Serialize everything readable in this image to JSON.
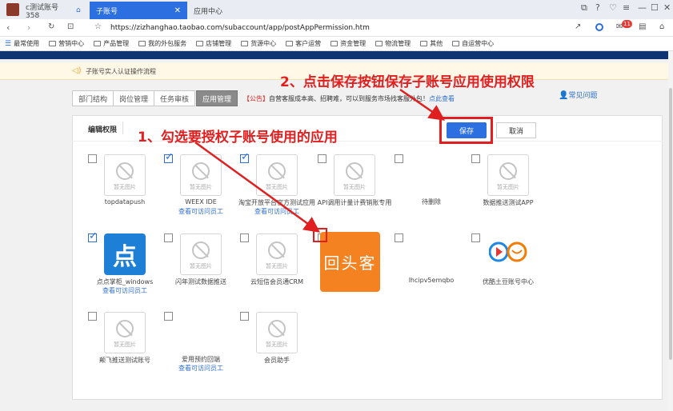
{
  "browser": {
    "tab1_title": "c测试账号358",
    "tab2_title": "子账号",
    "tab3_title": "应用中心",
    "url": "https://zizhanghao.taobao.com/subaccount/app/postAppPermission.htm",
    "mail_badge": "11"
  },
  "bookmarks": [
    "最常使用",
    "营销中心",
    "产品管理",
    "我的外包服务",
    "店铺管理",
    "货源中心",
    "客户运营",
    "资金管理",
    "物流管理",
    "其他",
    "自运营中心"
  ],
  "notice": {
    "text": "子账号实人认证操作流程"
  },
  "subtabs": [
    "部门结构",
    "岗位管理",
    "任务审核",
    "应用管理"
  ],
  "announcement": {
    "prefix": "【公告】",
    "text": "自营客服成本高、招聘难，可以到服务市场找客服外包！",
    "link": "点此查看"
  },
  "faq": "常见问题",
  "panel": {
    "title": "编辑权限",
    "save": "保存",
    "cancel": "取消"
  },
  "annotations": {
    "step1": "1、勾选要授权子账号使用的应用",
    "step2": "2、点击保存按钮保存子账号应用使用权限"
  },
  "placeholder_text": "暂无图片",
  "view_staff": "查看可访问员工",
  "apps": [
    {
      "name": "topdatapush",
      "checked": false,
      "link": false,
      "logo": "placeholder"
    },
    {
      "name": "WEEX IDE",
      "checked": true,
      "link": true,
      "logo": "placeholder"
    },
    {
      "name": "淘宝开放平台官方测试应用",
      "checked": true,
      "link": true,
      "logo": "placeholder"
    },
    {
      "name": "API调用计量计费销账专用",
      "checked": false,
      "link": false,
      "logo": "placeholder"
    },
    {
      "name": "待删除",
      "checked": false,
      "link": false,
      "logo": "none"
    },
    {
      "name": "数据推送测试APP",
      "checked": false,
      "link": false,
      "logo": "placeholder"
    },
    {
      "name": "点点掌柜_windows",
      "checked": true,
      "link": true,
      "logo": "diandian"
    },
    {
      "name": "闪年测试数据推送",
      "checked": false,
      "link": false,
      "logo": "placeholder"
    },
    {
      "name": "云短信会员通CRM",
      "checked": false,
      "link": false,
      "logo": "placeholder"
    },
    {
      "name": "回头客",
      "checked": false,
      "link": false,
      "logo": "huitouke"
    },
    {
      "name": "lhcipv5emqbo",
      "checked": false,
      "link": false,
      "logo": "none"
    },
    {
      "name": "优酷土豆账号中心",
      "checked": false,
      "link": false,
      "logo": "youku"
    },
    {
      "name": "颠飞推送测试账号",
      "checked": false,
      "link": false,
      "logo": "placeholder"
    },
    {
      "name": "爱用预约回端",
      "checked": false,
      "link": true,
      "logo": "none"
    },
    {
      "name": "会员助手",
      "checked": false,
      "link": false,
      "logo": "placeholder"
    }
  ],
  "colors": {
    "accent": "#2b6fe0",
    "annotation": "#e02020",
    "header_bar": "#0e3472",
    "orange": "#f58220"
  }
}
